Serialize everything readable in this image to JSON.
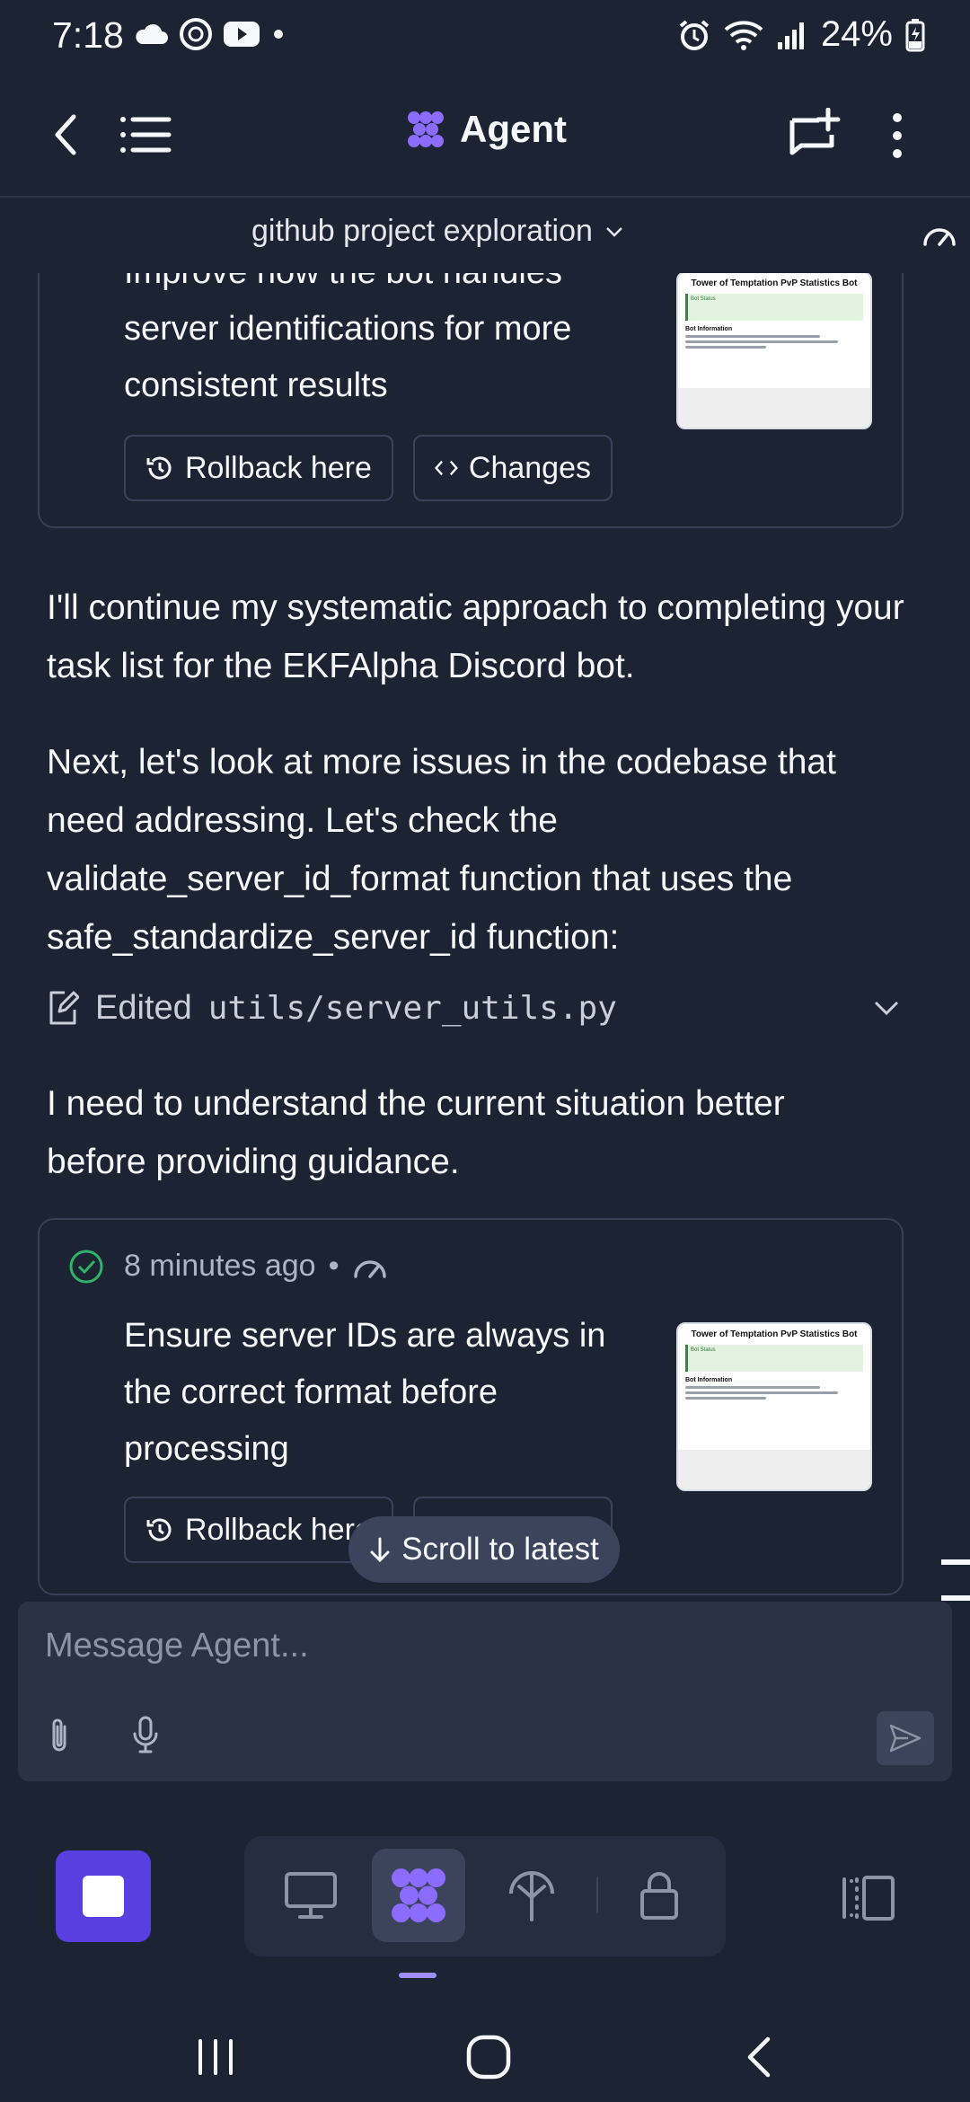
{
  "status_bar": {
    "time": "7:18",
    "battery": "24%",
    "left_icons": [
      "cloud-icon",
      "threads-icon",
      "youtube-icon",
      "dot-icon"
    ],
    "right_icons": [
      "alarm-icon",
      "wifi-icon",
      "signal-icon",
      "battery-charging-icon"
    ]
  },
  "header": {
    "title": "Agent",
    "accent_color": "#8b6cff",
    "left_icons": [
      "back-arrow-icon",
      "list-icon"
    ],
    "right_icons": [
      "new-chat-icon",
      "more-vertical-icon"
    ]
  },
  "subheader": {
    "project": "github project exploration",
    "right_icon": "gauge-icon"
  },
  "card1": {
    "text_partial": "Improve how the bot handles",
    "text_line2": "server identifications for more",
    "text_line3": "consistent results",
    "rollback_label": "Rollback here",
    "changes_label": "Changes",
    "thumbnail": {
      "title": "Tower of Temptation PvP Statistics Bot",
      "status_heading": "Bot Status",
      "info_heading": "Bot Information"
    }
  },
  "messages": {
    "para1": "I'll continue my systematic approach to completing your task list for the EKFAlpha Discord bot.",
    "para2_line1": "Next, let's look at more issues in the codebase that",
    "para2_line2": "need addressing. Let's check the",
    "para2_line3": "validate_server_id_format function that uses the",
    "para2_line4": "safe_standardize_server_id function:",
    "edited_prefix": "Edited",
    "edited_file": "utils/server_utils.py",
    "para3_line1": "I need to understand the current situation better",
    "para3_line2": "before providing guidance."
  },
  "card2": {
    "time_ago": "8 minutes ago",
    "separator": "•",
    "text_line1": "Ensure server IDs are always in",
    "text_line2": "the correct format before",
    "text_line3": "processing",
    "rollback_label": "Rollback here",
    "thumbnail": {
      "title": "Tower of Temptation PvP Statistics Bot",
      "status_heading": "Bot Status",
      "info_heading": "Bot Information"
    }
  },
  "scroll_latest": "Scroll to latest",
  "composer": {
    "placeholder": "Message Agent..."
  },
  "toolbar": {
    "tools": [
      "monitor-icon",
      "agent-icon",
      "network-icon",
      "lock-icon"
    ],
    "active": "agent-icon",
    "right_icon": "split-view-icon"
  },
  "nav": [
    "recents-icon",
    "home-icon",
    "back-icon"
  ]
}
